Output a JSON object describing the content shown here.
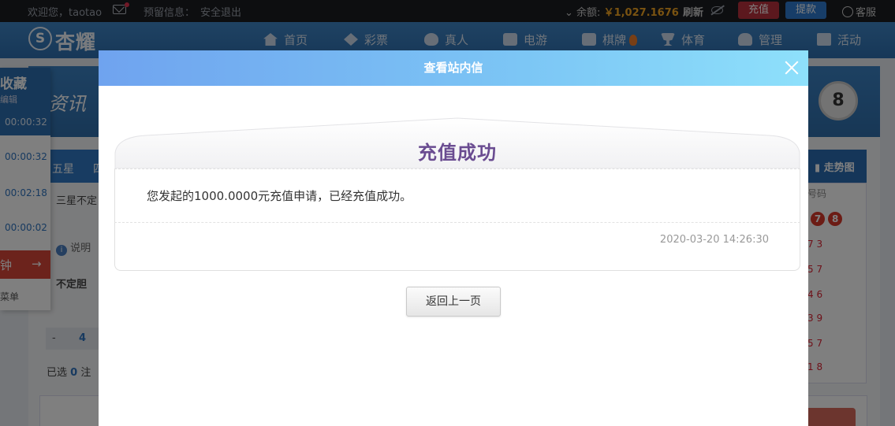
{
  "topbar": {
    "welcome": "欢迎您，",
    "username": "taotao",
    "reserve_label": "预留信息：",
    "logout": "安全退出",
    "balance_label": "余额:",
    "balance": "￥1,027.1676",
    "refresh": "刷新",
    "charge": "充值",
    "withdraw": "提款",
    "service": "客服"
  },
  "nav": {
    "logo": "杏耀",
    "items": [
      {
        "label": "首页",
        "icon": "home-icon"
      },
      {
        "label": "彩票",
        "icon": "lottery-icon"
      },
      {
        "label": "真人",
        "icon": "live-dealer-icon"
      },
      {
        "label": "电游",
        "icon": "slot-icon"
      },
      {
        "label": "棋牌",
        "icon": "cards-icon"
      },
      {
        "label": "体育",
        "icon": "trophy-icon"
      },
      {
        "label": "管理",
        "icon": "users-icon"
      },
      {
        "label": "活动",
        "icon": "gift-icon"
      }
    ]
  },
  "background": {
    "favorite": "收藏",
    "edit": "编辑",
    "times": [
      "00:00:32",
      "00:00:32",
      "00:02:18",
      "00:00:02"
    ],
    "tab_wuxing": "五星",
    "tab_partial": "四",
    "trend": "走势图",
    "sanxing": "三星不定",
    "note_label": "说明",
    "budingdan": "不定胆",
    "counter_minus": "-",
    "counter_value": "4",
    "selected_prefix": "已选",
    "selected_count": "0",
    "selected_suffix": "注",
    "ball_number": "8",
    "right_header": "号码",
    "right_balls": [
      "7",
      "8"
    ],
    "right_rows": [
      "7 3",
      "5 7",
      "4 6",
      "3 9",
      "5 7",
      "1 8"
    ],
    "side_red": "钟",
    "side_menu": "菜单",
    "banner_text": "资讯"
  },
  "modal": {
    "title": "查看站内信",
    "letter_title": "充值成功",
    "body": "您发起的1000.0000元充值申请，已经充值成功。",
    "time": "2020-03-20 14:26:30",
    "back_button": "返回上一页"
  }
}
